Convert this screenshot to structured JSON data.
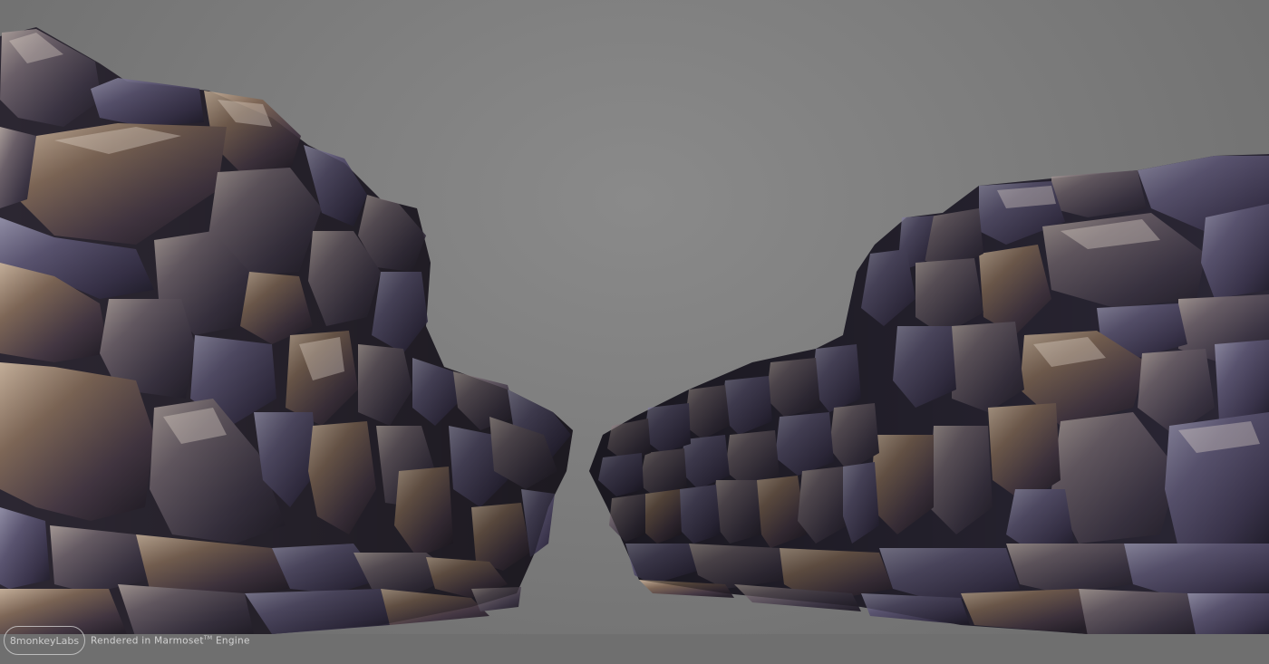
{
  "watermark": {
    "logo_text": "8monkeyLabs",
    "caption_prefix": "Rendered in Marmoset",
    "caption_tm": "TM",
    "caption_suffix": " Engine"
  },
  "colors": {
    "background": "#7a7a7a",
    "stone_dark": "#2e2a36",
    "stone_mid": "#4f4858",
    "stone_highlight": "#b8a89a",
    "stone_warm": "#8a6a52"
  }
}
